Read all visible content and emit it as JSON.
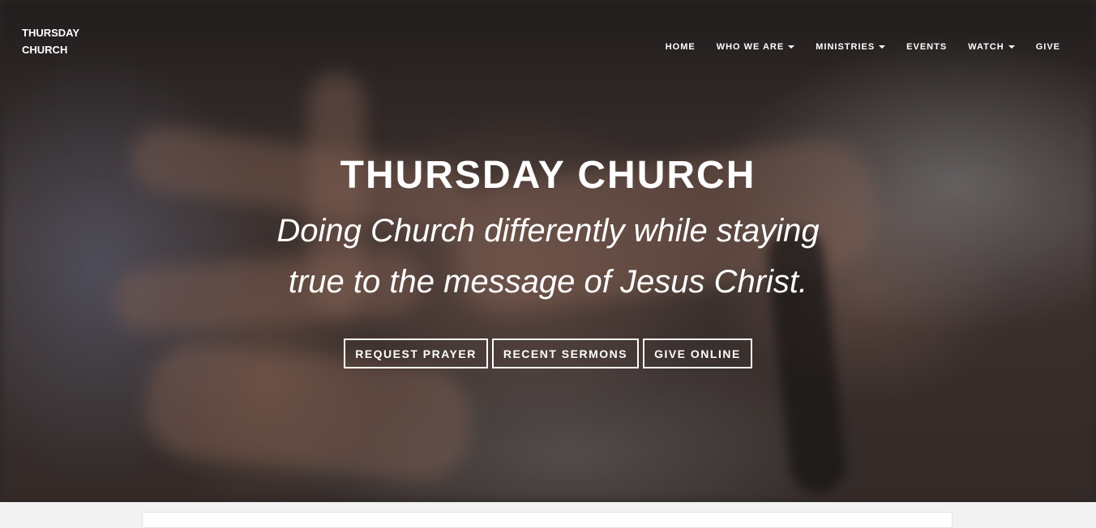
{
  "brand": {
    "line1": "THURSDAY",
    "line2": "CHURCH"
  },
  "nav": {
    "items": [
      {
        "label": "HOME",
        "dropdown": false
      },
      {
        "label": "WHO WE ARE",
        "dropdown": true
      },
      {
        "label": "MINISTRIES",
        "dropdown": true
      },
      {
        "label": "EVENTS",
        "dropdown": false
      },
      {
        "label": "WATCH",
        "dropdown": true
      },
      {
        "label": "GIVE",
        "dropdown": false
      }
    ]
  },
  "hero": {
    "title": "THURSDAY CHURCH",
    "tagline_line1": "Doing Church differently while staying",
    "tagline_line2": "true to the message of Jesus Christ.",
    "buttons": [
      "REQUEST PRAYER",
      "RECENT SERMONS",
      "GIVE ONLINE"
    ]
  },
  "colors": {
    "text": "#ffffff",
    "overlay": "#191414",
    "page_bg": "#f2f2f2"
  }
}
